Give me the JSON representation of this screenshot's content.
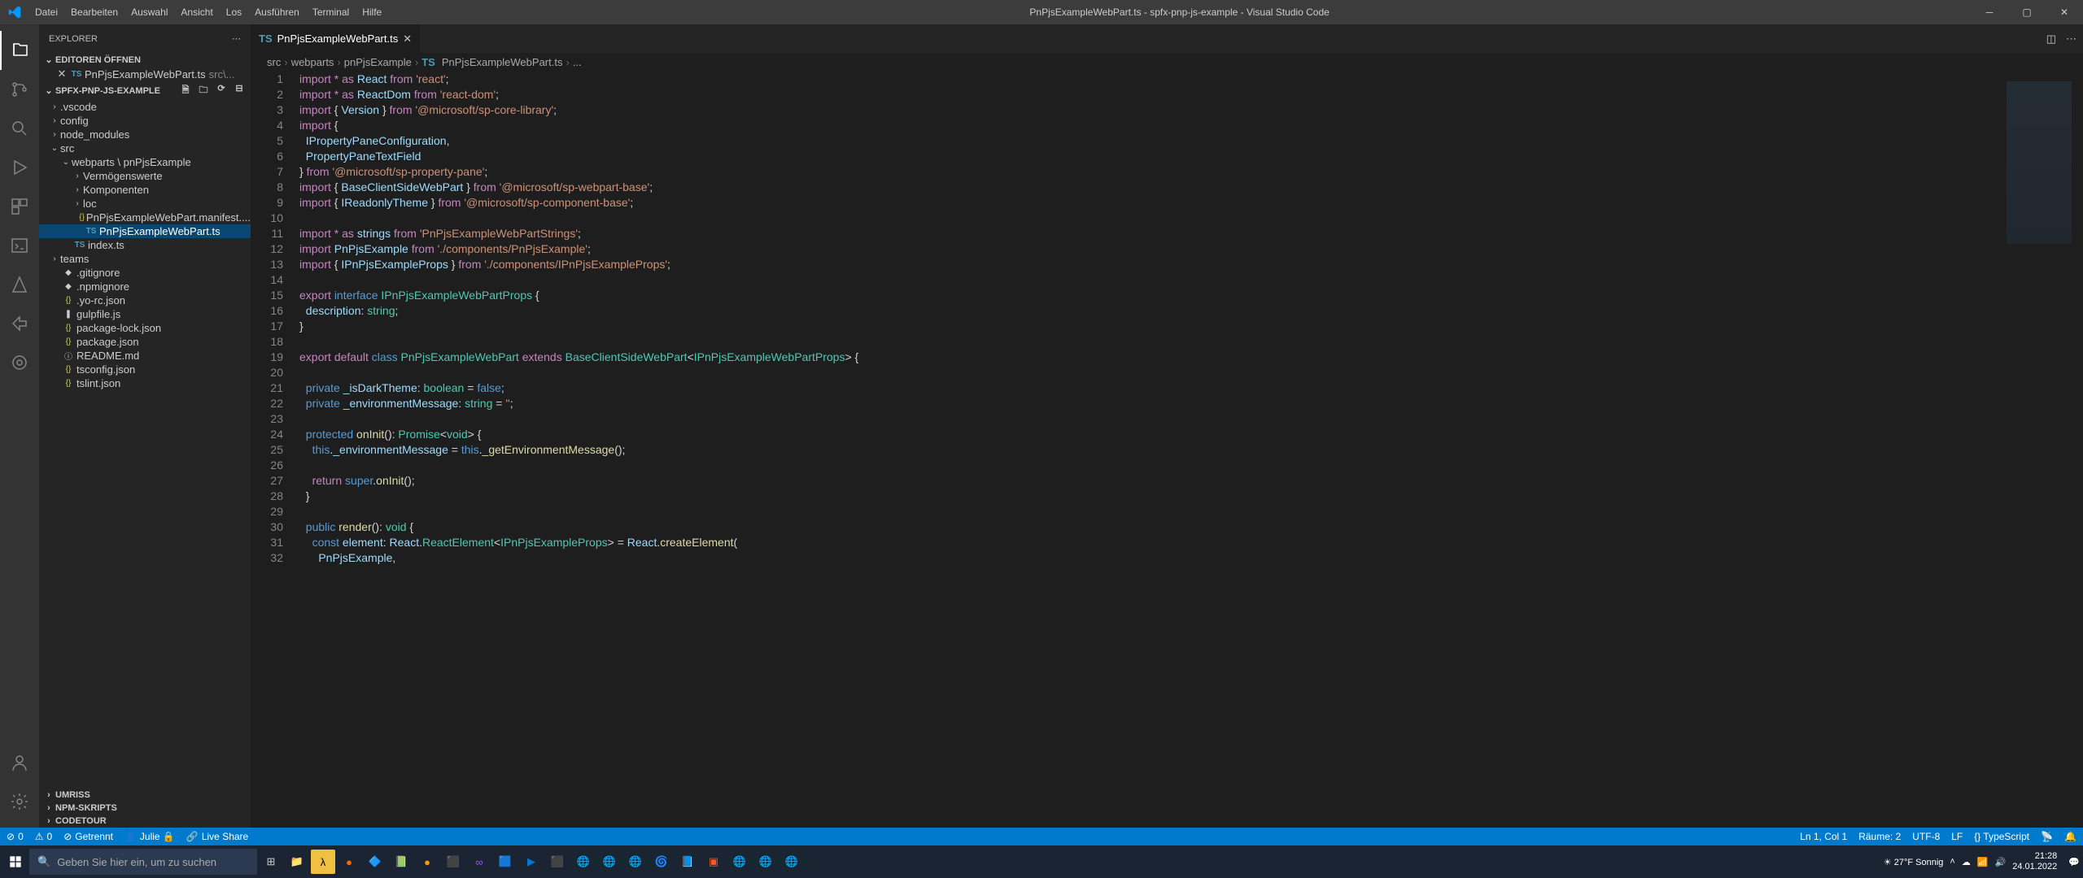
{
  "titlebar": {
    "menus": [
      "Datei",
      "Bearbeiten",
      "Auswahl",
      "Ansicht",
      "Los",
      "Ausführen",
      "Terminal",
      "Hilfe"
    ],
    "title": "PnPjsExampleWebPart.ts - spfx-pnp-js-example - Visual Studio Code"
  },
  "sidebar": {
    "title": "EXPLORER",
    "openEditors": {
      "label": "EDITOREN ÖFFNEN",
      "items": [
        {
          "icon": "TS",
          "name": "PnPjsExampleWebPart.ts",
          "path": "src\\..."
        }
      ]
    },
    "project": {
      "label": "SPFX-PNP-JS-EXAMPLE",
      "tree": [
        {
          "indent": 0,
          "chev": "›",
          "name": ".vscode",
          "type": "folder"
        },
        {
          "indent": 0,
          "chev": "›",
          "name": "config",
          "type": "folder"
        },
        {
          "indent": 0,
          "chev": "›",
          "name": "node_modules",
          "type": "folder"
        },
        {
          "indent": 0,
          "chev": "⌄",
          "name": "src",
          "type": "folder"
        },
        {
          "indent": 1,
          "chev": "⌄",
          "name": "webparts \\ pnPjsExample",
          "type": "folder"
        },
        {
          "indent": 2,
          "chev": "›",
          "name": "Vermögenswerte",
          "type": "folder"
        },
        {
          "indent": 2,
          "chev": "›",
          "name": "Komponenten",
          "type": "folder"
        },
        {
          "indent": 2,
          "chev": "›",
          "name": "loc",
          "type": "folder"
        },
        {
          "indent": 2,
          "chev": "",
          "icon": "{}",
          "name": "PnPjsExampleWebPart.manifest....",
          "type": "file"
        },
        {
          "indent": 2,
          "chev": "",
          "icon": "TS",
          "name": "PnPjsExampleWebPart.ts",
          "type": "file",
          "selected": true
        },
        {
          "indent": 1,
          "chev": "",
          "icon": "TS",
          "name": "index.ts",
          "type": "file"
        },
        {
          "indent": 0,
          "chev": "›",
          "name": "teams",
          "type": "folder"
        },
        {
          "indent": 0,
          "chev": "",
          "icon": "◆",
          "name": ".gitignore",
          "type": "file"
        },
        {
          "indent": 0,
          "chev": "",
          "icon": "◆",
          "name": ".npmignore",
          "type": "file"
        },
        {
          "indent": 0,
          "chev": "",
          "icon": "{}",
          "name": ".yo-rc.json",
          "type": "file"
        },
        {
          "indent": 0,
          "chev": "",
          "icon": "❚",
          "name": "gulpfile.js",
          "type": "file"
        },
        {
          "indent": 0,
          "chev": "",
          "icon": "{}",
          "name": "package-lock.json",
          "type": "file"
        },
        {
          "indent": 0,
          "chev": "",
          "icon": "{}",
          "name": "package.json",
          "type": "file"
        },
        {
          "indent": 0,
          "chev": "",
          "icon": "ⓘ",
          "name": "README.md",
          "type": "file"
        },
        {
          "indent": 0,
          "chev": "",
          "icon": "{}",
          "name": "tsconfig.json",
          "type": "file"
        },
        {
          "indent": 0,
          "chev": "",
          "icon": "{}",
          "name": "tslint.json",
          "type": "file"
        }
      ]
    },
    "collapsed": [
      "UMRISS",
      "NPM-SKRIPTS",
      "CODETOUR"
    ]
  },
  "editor": {
    "tab": {
      "icon": "TS",
      "name": "PnPjsExampleWebPart.ts"
    },
    "breadcrumbs": [
      "src",
      "webparts",
      "pnPjsExample",
      "PnPjsExampleWebPart.ts",
      "..."
    ],
    "breadcrumb_icon": "TS",
    "lines": 32
  },
  "statusbar": {
    "left": [
      {
        "icon": "⊘",
        "text": "0"
      },
      {
        "icon": "⚠",
        "text": "0"
      },
      {
        "icon": "⊘",
        "text": "Getrennt"
      },
      {
        "icon": "👤",
        "text": "Julie 🔒"
      },
      {
        "icon": "🔗",
        "text": "Live Share"
      }
    ],
    "right": [
      "Ln 1, Col 1",
      "Räume: 2",
      "UTF-8",
      "LF",
      "{} TypeScript",
      "📡",
      "🔔"
    ]
  },
  "taskbar": {
    "search_placeholder": "Geben Sie hier ein, um zu suchen",
    "weather": {
      "temp": "27°F",
      "label": "Sonnig"
    },
    "time": "21:28",
    "date": "24.01.2022"
  },
  "code": [
    [
      [
        "kw",
        "import"
      ],
      [
        "",
        " "
      ],
      [
        "kw",
        "*"
      ],
      [
        "",
        " "
      ],
      [
        "kw",
        "as"
      ],
      [
        "",
        " "
      ],
      [
        "var",
        "React"
      ],
      [
        "",
        " "
      ],
      [
        "kw",
        "from"
      ],
      [
        "",
        " "
      ],
      [
        "str",
        "'react'"
      ],
      [
        "",
        ";"
      ]
    ],
    [
      [
        "kw",
        "import"
      ],
      [
        "",
        " "
      ],
      [
        "kw",
        "*"
      ],
      [
        "",
        " "
      ],
      [
        "kw",
        "as"
      ],
      [
        "",
        " "
      ],
      [
        "var",
        "ReactDom"
      ],
      [
        "",
        " "
      ],
      [
        "kw",
        "from"
      ],
      [
        "",
        " "
      ],
      [
        "str",
        "'react-dom'"
      ],
      [
        "",
        ";"
      ]
    ],
    [
      [
        "kw",
        "import"
      ],
      [
        "",
        " { "
      ],
      [
        "var",
        "Version"
      ],
      [
        "",
        " } "
      ],
      [
        "kw",
        "from"
      ],
      [
        "",
        " "
      ],
      [
        "str",
        "'@microsoft/sp-core-library'"
      ],
      [
        "",
        ";"
      ]
    ],
    [
      [
        "kw",
        "import"
      ],
      [
        "",
        " {"
      ]
    ],
    [
      [
        "",
        "  "
      ],
      [
        "var",
        "IPropertyPaneConfiguration"
      ],
      [
        "",
        ","
      ]
    ],
    [
      [
        "",
        "  "
      ],
      [
        "var",
        "PropertyPaneTextField"
      ]
    ],
    [
      [
        "",
        "} "
      ],
      [
        "kw",
        "from"
      ],
      [
        "",
        " "
      ],
      [
        "str",
        "'@microsoft/sp-property-pane'"
      ],
      [
        "",
        ";"
      ]
    ],
    [
      [
        "kw",
        "import"
      ],
      [
        "",
        " { "
      ],
      [
        "var",
        "BaseClientSideWebPart"
      ],
      [
        "",
        " } "
      ],
      [
        "kw",
        "from"
      ],
      [
        "",
        " "
      ],
      [
        "str",
        "'@microsoft/sp-webpart-base'"
      ],
      [
        "",
        ";"
      ]
    ],
    [
      [
        "kw",
        "import"
      ],
      [
        "",
        " { "
      ],
      [
        "var",
        "IReadonlyTheme"
      ],
      [
        "",
        " } "
      ],
      [
        "kw",
        "from"
      ],
      [
        "",
        " "
      ],
      [
        "str",
        "'@microsoft/sp-component-base'"
      ],
      [
        "",
        ";"
      ]
    ],
    [],
    [
      [
        "kw",
        "import"
      ],
      [
        "",
        " "
      ],
      [
        "kw",
        "*"
      ],
      [
        "",
        " "
      ],
      [
        "kw",
        "as"
      ],
      [
        "",
        " "
      ],
      [
        "var",
        "strings"
      ],
      [
        "",
        " "
      ],
      [
        "kw",
        "from"
      ],
      [
        "",
        " "
      ],
      [
        "str",
        "'PnPjsExampleWebPartStrings'"
      ],
      [
        "",
        ";"
      ]
    ],
    [
      [
        "kw",
        "import"
      ],
      [
        "",
        " "
      ],
      [
        "var",
        "PnPjsExample"
      ],
      [
        "",
        " "
      ],
      [
        "kw",
        "from"
      ],
      [
        "",
        " "
      ],
      [
        "str",
        "'./components/PnPjsExample'"
      ],
      [
        "",
        ";"
      ]
    ],
    [
      [
        "kw",
        "import"
      ],
      [
        "",
        " { "
      ],
      [
        "var",
        "IPnPjsExampleProps"
      ],
      [
        "",
        " } "
      ],
      [
        "kw",
        "from"
      ],
      [
        "",
        " "
      ],
      [
        "str",
        "'./components/IPnPjsExampleProps'"
      ],
      [
        "",
        ";"
      ]
    ],
    [],
    [
      [
        "kw",
        "export"
      ],
      [
        "",
        " "
      ],
      [
        "blue",
        "interface"
      ],
      [
        "",
        " "
      ],
      [
        "type",
        "IPnPjsExampleWebPartProps"
      ],
      [
        "",
        " {"
      ]
    ],
    [
      [
        "",
        "  "
      ],
      [
        "var",
        "description"
      ],
      [
        "",
        ": "
      ],
      [
        "type",
        "string"
      ],
      [
        "",
        ";"
      ]
    ],
    [
      [
        "",
        "}"
      ]
    ],
    [],
    [
      [
        "kw",
        "export"
      ],
      [
        "",
        " "
      ],
      [
        "kw",
        "default"
      ],
      [
        "",
        " "
      ],
      [
        "blue",
        "class"
      ],
      [
        "",
        " "
      ],
      [
        "type",
        "PnPjsExampleWebPart"
      ],
      [
        "",
        " "
      ],
      [
        "kw",
        "extends"
      ],
      [
        "",
        " "
      ],
      [
        "type",
        "BaseClientSideWebPart"
      ],
      [
        "",
        "<"
      ],
      [
        "type",
        "IPnPjsExampleWebPartProps"
      ],
      [
        "",
        "> {"
      ]
    ],
    [],
    [
      [
        "",
        "  "
      ],
      [
        "blue",
        "private"
      ],
      [
        "",
        " "
      ],
      [
        "var",
        "_isDarkTheme"
      ],
      [
        "",
        ": "
      ],
      [
        "type",
        "boolean"
      ],
      [
        "",
        " = "
      ],
      [
        "blue",
        "false"
      ],
      [
        "",
        ";"
      ]
    ],
    [
      [
        "",
        "  "
      ],
      [
        "blue",
        "private"
      ],
      [
        "",
        " "
      ],
      [
        "var",
        "_environmentMessage"
      ],
      [
        "",
        ": "
      ],
      [
        "type",
        "string"
      ],
      [
        "",
        " = "
      ],
      [
        "str",
        "''"
      ],
      [
        "",
        ";"
      ]
    ],
    [],
    [
      [
        "",
        "  "
      ],
      [
        "blue",
        "protected"
      ],
      [
        "",
        " "
      ],
      [
        "fn",
        "onInit"
      ],
      [
        "",
        "(): "
      ],
      [
        "type",
        "Promise"
      ],
      [
        "",
        "<"
      ],
      [
        "type",
        "void"
      ],
      [
        "",
        "> {"
      ]
    ],
    [
      [
        "",
        "    "
      ],
      [
        "blue",
        "this"
      ],
      [
        "",
        "."
      ],
      [
        "var",
        "_environmentMessage"
      ],
      [
        "",
        " = "
      ],
      [
        "blue",
        "this"
      ],
      [
        "",
        "."
      ],
      [
        "fn",
        "_getEnvironmentMessage"
      ],
      [
        "",
        "();"
      ]
    ],
    [],
    [
      [
        "",
        "    "
      ],
      [
        "kw",
        "return"
      ],
      [
        "",
        " "
      ],
      [
        "blue",
        "super"
      ],
      [
        "",
        "."
      ],
      [
        "fn",
        "onInit"
      ],
      [
        "",
        "();"
      ]
    ],
    [
      [
        "",
        "  }"
      ]
    ],
    [],
    [
      [
        "",
        "  "
      ],
      [
        "blue",
        "public"
      ],
      [
        "",
        " "
      ],
      [
        "fn",
        "render"
      ],
      [
        "",
        "(): "
      ],
      [
        "type",
        "void"
      ],
      [
        "",
        " {"
      ]
    ],
    [
      [
        "",
        "    "
      ],
      [
        "blue",
        "const"
      ],
      [
        "",
        " "
      ],
      [
        "var",
        "element"
      ],
      [
        "",
        ": "
      ],
      [
        "var",
        "React"
      ],
      [
        "",
        "."
      ],
      [
        "type",
        "ReactElement"
      ],
      [
        "",
        "<"
      ],
      [
        "type",
        "IPnPjsExampleProps"
      ],
      [
        "",
        "> = "
      ],
      [
        "var",
        "React"
      ],
      [
        "",
        "."
      ],
      [
        "fn",
        "createElement"
      ],
      [
        "",
        "("
      ]
    ],
    [
      [
        "",
        "      "
      ],
      [
        "var",
        "PnPjsExample"
      ],
      [
        "",
        ","
      ]
    ]
  ]
}
